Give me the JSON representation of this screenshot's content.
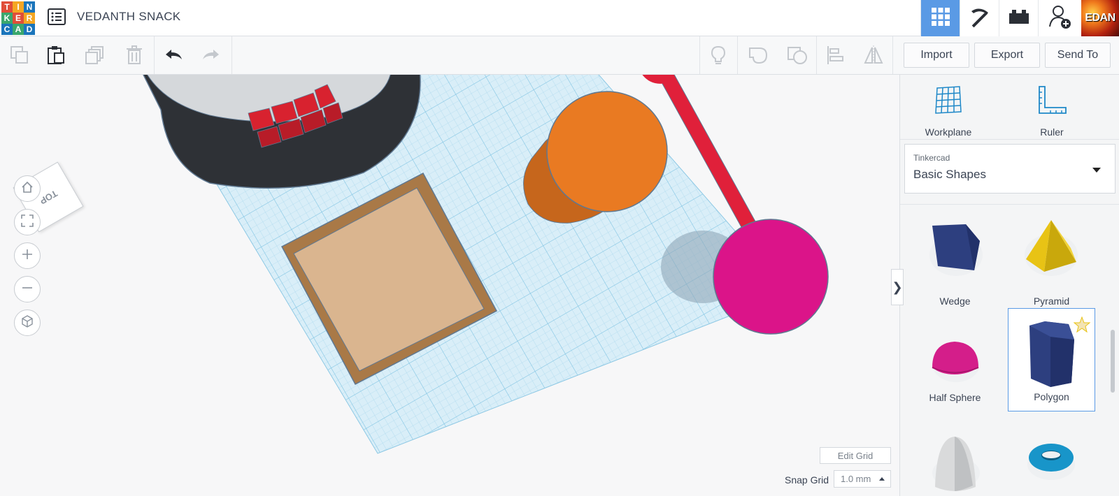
{
  "header": {
    "logo_letters": [
      "T",
      "I",
      "N",
      "K",
      "E",
      "R",
      "C",
      "A",
      "D"
    ],
    "design_title": "VEDANTH SNACK",
    "avatar_text": "EDAN",
    "buttons": [
      {
        "name": "3d-design-view-button",
        "icon": "grid-icon",
        "active": true
      },
      {
        "name": "codeblocks-button",
        "icon": "pickaxe-icon",
        "active": false
      },
      {
        "name": "bricks-button",
        "icon": "brick-icon",
        "active": false
      },
      {
        "name": "add-user-button",
        "icon": "user-plus-icon",
        "active": false
      }
    ]
  },
  "toolbar": {
    "icons": [
      "copy-icon",
      "paste-icon",
      "duplicate-icon",
      "trash-icon",
      "undo-icon",
      "redo-icon",
      "lightbulb-icon",
      "group-icon",
      "ungroup-icon",
      "align-icon",
      "mirror-icon"
    ],
    "import_label": "Import",
    "export_label": "Export",
    "send_to_label": "Send To"
  },
  "workspace": {
    "view_cube_label": "TOP",
    "nav_icons": [
      "home-icon",
      "fit-view-icon",
      "zoom-in-icon",
      "zoom-out-icon",
      "perspective-icon"
    ],
    "edit_grid_label": "Edit Grid",
    "snap_grid_label": "Snap Grid",
    "snap_grid_value": "1.0 mm"
  },
  "right_panel": {
    "toggle_glyph": "❯",
    "workplane_label": "Workplane",
    "ruler_label": "Ruler",
    "library_category": "Tinkercad",
    "library_name": "Basic Shapes",
    "shapes": [
      {
        "label": "Wedge",
        "color": "#2d3f7f",
        "selected": false
      },
      {
        "label": "Pyramid",
        "color": "#e8c315",
        "selected": false
      },
      {
        "label": "Half Sphere",
        "color": "#d41e8a",
        "selected": false
      },
      {
        "label": "Polygon",
        "color": "#2d3f7f",
        "selected": true
      },
      {
        "label": "",
        "color": "#d9dadb",
        "selected": false
      },
      {
        "label": "",
        "color": "#1895c9",
        "selected": false
      }
    ]
  },
  "colors": {
    "accent": "#5a9ae5",
    "grid": "#bfe3f3",
    "cylinder": "#e97a22",
    "sphere": "#db1489",
    "box_outer": "#a97947",
    "box_inner": "#dab58f",
    "stick": "#e0203a"
  }
}
